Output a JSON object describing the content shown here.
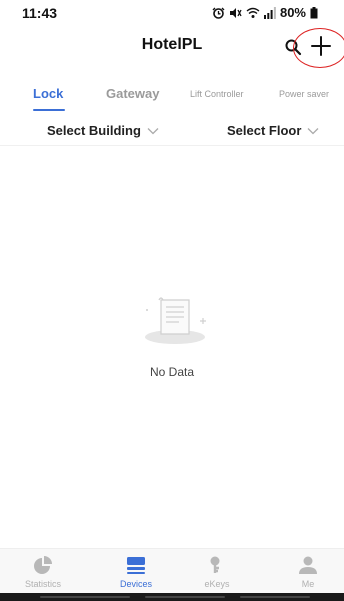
{
  "status_bar": {
    "time": "11:43",
    "battery": "80%"
  },
  "header": {
    "title": "HotelPL",
    "icons": [
      "search-icon",
      "add-icon"
    ]
  },
  "tabs": [
    {
      "label": "Lock",
      "active": true
    },
    {
      "label": "Gateway",
      "active": false
    },
    {
      "label": "Lift Controller",
      "active": false
    },
    {
      "label": "Power saver",
      "active": false
    }
  ],
  "filters": {
    "building": "Select Building",
    "floor": "Select Floor"
  },
  "empty_state": {
    "message": "No Data"
  },
  "bottom_nav": [
    {
      "label": "Statistics",
      "icon": "pie-chart-icon",
      "active": false
    },
    {
      "label": "Devices",
      "icon": "devices-icon",
      "active": true
    },
    {
      "label": "eKeys",
      "icon": "key-icon",
      "active": false
    },
    {
      "label": "Me",
      "icon": "person-icon",
      "active": false
    }
  ],
  "colors": {
    "accent": "#3b6fd6",
    "inactive": "#9a9a9a",
    "annotation": "#dd2222"
  }
}
